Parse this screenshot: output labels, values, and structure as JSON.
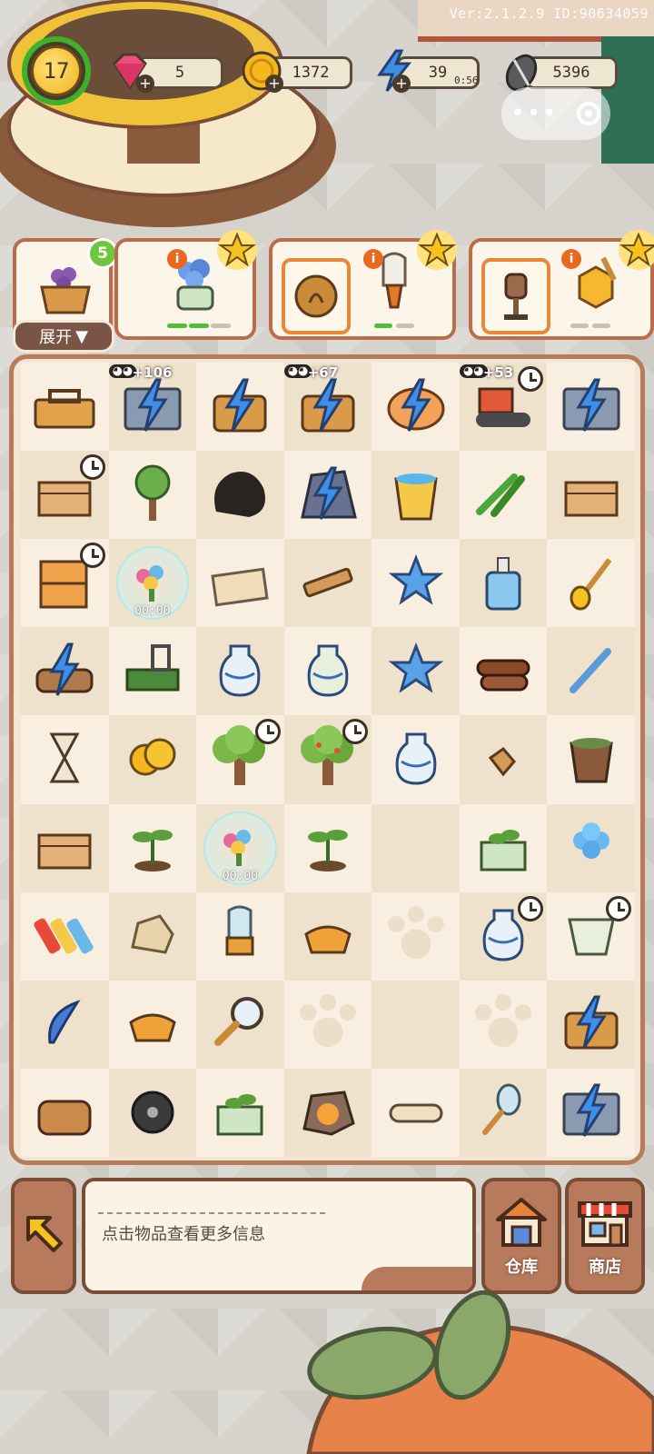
{
  "version_text": "Ver:2.1.2.9 ID:90634059",
  "player": {
    "level": "17"
  },
  "resources": {
    "gems": "5",
    "coins": "1372",
    "energy": "39",
    "energy_timer": "0:56",
    "seeds": "5396"
  },
  "orders": {
    "main_count": "5",
    "expand_label": "展开",
    "expand_arrow": "▼",
    "info_glyph": "i"
  },
  "board": {
    "cells": [
      [
        "toolbox",
        "energy-crate",
        "energy-chest",
        "energy-basket",
        "energy-piggy-bank",
        "toy-tractor",
        "energy-crate-map"
      ],
      [
        "cardboard-boxes",
        "small-tree",
        "dark-mystery-blob",
        "energy-rock",
        "water-bucket",
        "garden-shears",
        "wooden-tray"
      ],
      [
        "wooden-cabinet",
        "flower-bubble",
        "paper-stack",
        "wood-plank",
        "blue-stars",
        "soap-dispenser",
        "honey-dipper"
      ],
      [
        "energy-logs",
        "green-cart",
        "blue-vase",
        "white-vase",
        "blue-star",
        "wood-logs",
        "dropper"
      ],
      [
        "hourglass",
        "coins",
        "tree-large",
        "fruit-tree",
        "sprout-vase",
        "broken-pot",
        "clay-pot"
      ],
      [
        "seed-tray",
        "seedling",
        "flower-bubble",
        "seedling-small",
        "empty",
        "plant-box",
        "blue-flower"
      ],
      [
        "paint-tubes",
        "stone",
        "lightbulb",
        "seed-bag",
        "paw",
        "blue-vase-plant",
        "ceramic-cup"
      ],
      [
        "blue-feather",
        "seed-bags",
        "magnifier",
        "paw",
        "empty",
        "paw",
        "energy-basket"
      ],
      [
        "sack-pile",
        "wheel",
        "potted-plant",
        "ore-rock",
        "scroll",
        "spoon",
        "energy-cart"
      ]
    ],
    "timers": {
      "bubble_1": "00:00",
      "bubble_2": "00:00"
    },
    "bonuses": [
      "+106",
      "+67",
      "+53"
    ]
  },
  "bottom": {
    "info_text": "点击物品查看更多信息",
    "warehouse_label": "仓库",
    "shop_label": "商店"
  },
  "colors": {
    "border_brown": "#b96d4a",
    "board_bg": "#f2e7d6",
    "accent_green": "#6fc63d",
    "energy_blue": "#3f8ee8"
  }
}
